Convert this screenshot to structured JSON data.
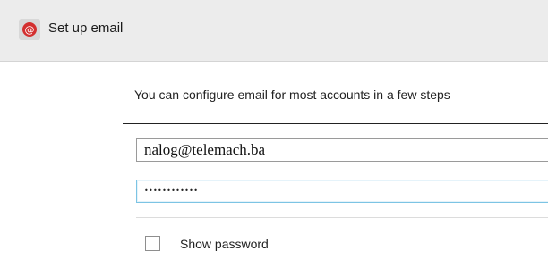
{
  "header": {
    "icon": "email-at-icon",
    "title": "Set up email",
    "accent_color": "#d32f2f"
  },
  "main": {
    "intro_text": "You can configure email for most accounts in a few steps",
    "email_field": {
      "value": "nalog@telemach.ba"
    },
    "password_field": {
      "masked_value": "••••••••••••"
    },
    "show_password": {
      "label": "Show password",
      "checked": false
    }
  }
}
